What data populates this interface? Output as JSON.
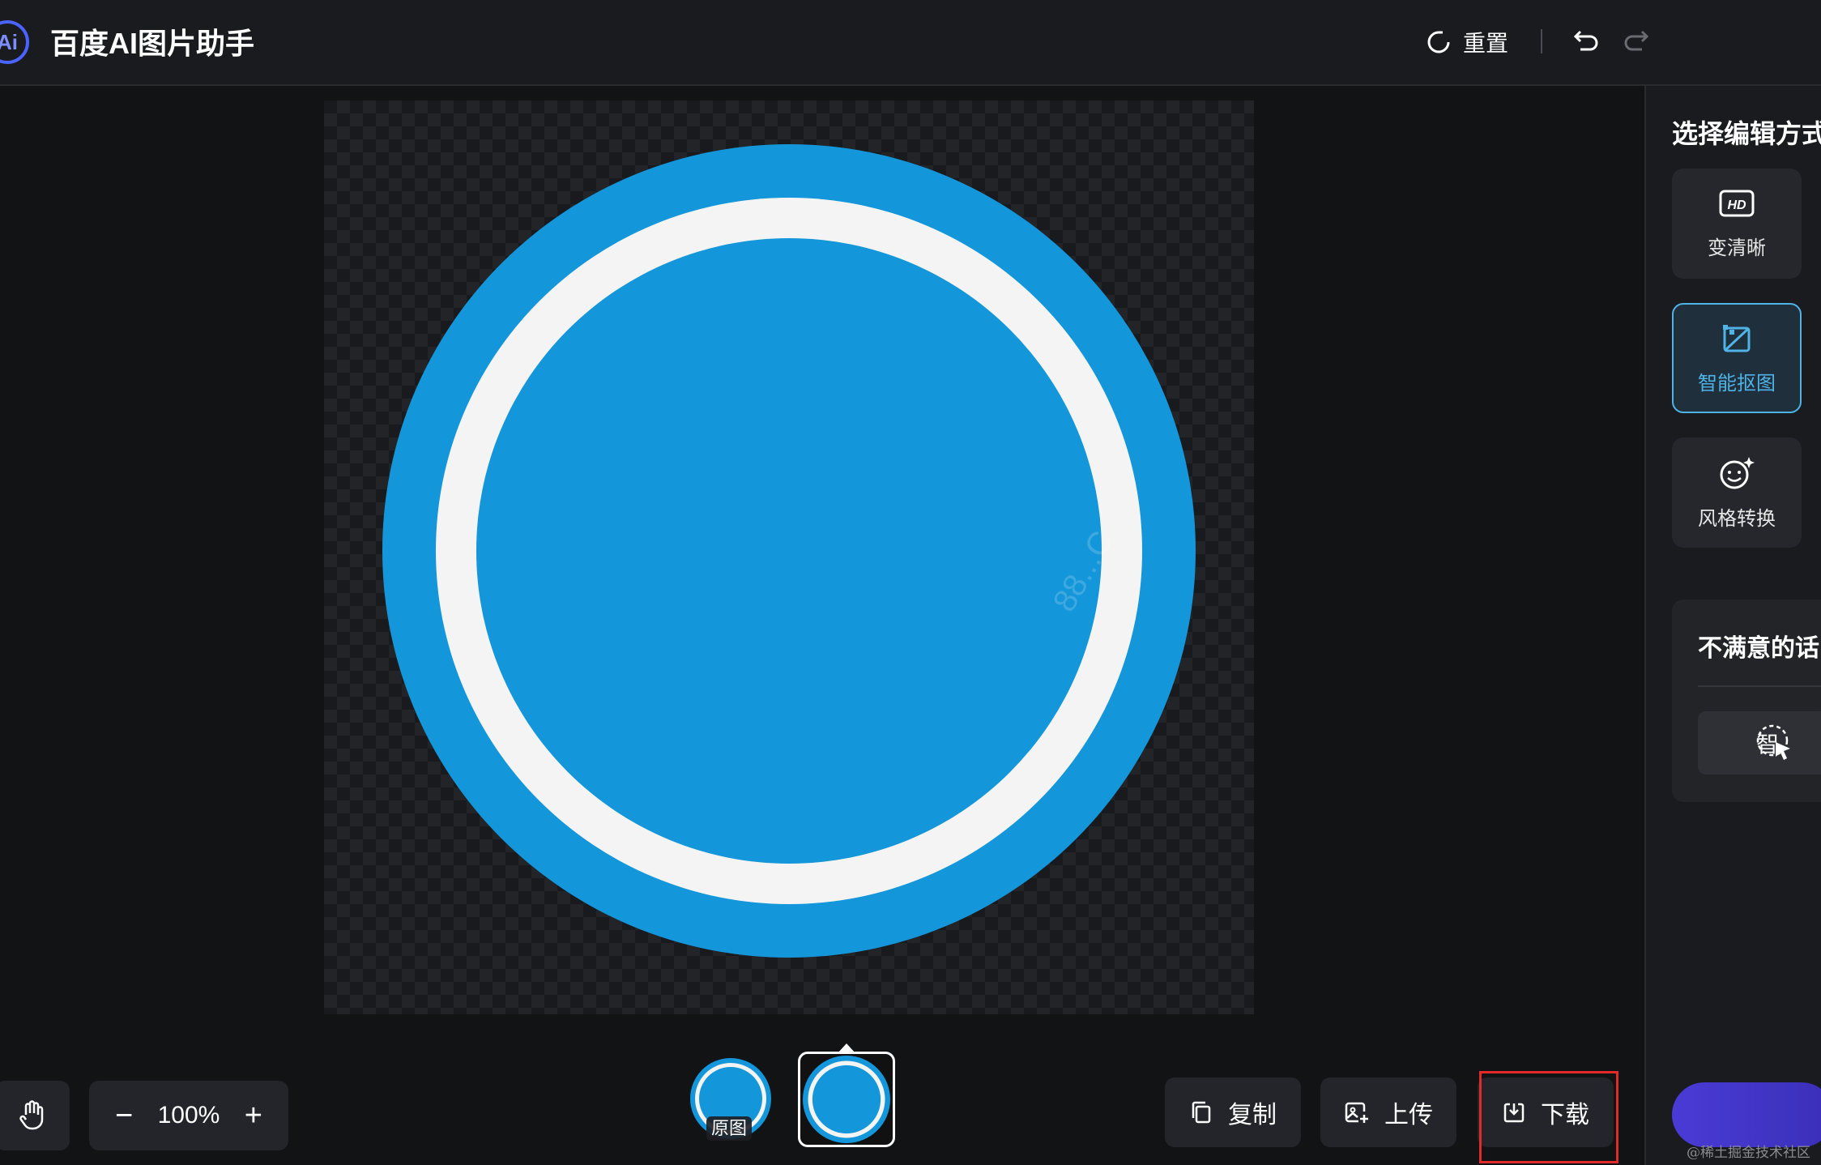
{
  "header": {
    "logo_text": "Ai",
    "title": "百度AI图片助手",
    "reset_label": "重置",
    "icons": {
      "reset": "refresh-icon",
      "undo": "undo-icon",
      "redo": "redo-icon"
    }
  },
  "canvas": {
    "image_colors": {
      "outer": "#1496da",
      "ring": "#f4f4f4",
      "inner": "#1496da"
    },
    "image_watermark": "88...C"
  },
  "toolbar": {
    "hand_icon": "hand-icon",
    "zoom_value": "100%",
    "zoom_out_label": "−",
    "zoom_in_label": "+"
  },
  "thumbnails": {
    "original_label": "原图"
  },
  "actions": {
    "copy_label": "复制",
    "upload_label": "上传",
    "download_label": "下载"
  },
  "panel": {
    "title": "选择编辑方式",
    "tools": [
      {
        "label": "变清晰",
        "icon": "hd-icon"
      },
      {
        "label": "智能抠图",
        "icon": "cutout-icon",
        "active": true
      },
      {
        "label": "风格转换",
        "icon": "style-smile-icon"
      }
    ],
    "feedback_title": "不满意的话",
    "smart_select_label": "智"
  },
  "accent_color": "#4fb3e8",
  "highlight_color": "#e22a2a",
  "footer_watermark": "@稀土掘金技术社区"
}
